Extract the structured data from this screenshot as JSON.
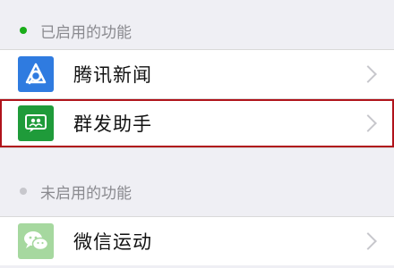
{
  "enabled_section": {
    "title": "已启用的功能",
    "dot_color": "#1aad19",
    "items": [
      {
        "label": "腾讯新闻",
        "icon": "tencent-news-icon",
        "icon_color": "#2f7be0"
      },
      {
        "label": "群发助手",
        "icon": "mass-message-icon",
        "icon_color": "#1f9b3a",
        "highlighted": true
      }
    ]
  },
  "disabled_section": {
    "title": "未启用的功能",
    "dot_color": "#c7c7cc",
    "items": [
      {
        "label": "微信运动",
        "icon": "wechat-icon",
        "icon_color": "#a6d89f"
      }
    ]
  }
}
